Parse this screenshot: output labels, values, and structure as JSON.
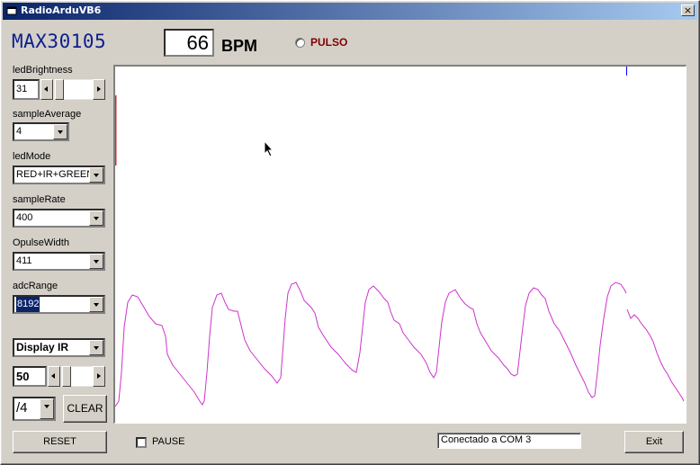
{
  "window": {
    "title": "RadioArduVB6",
    "close_glyph": "×"
  },
  "header": {
    "device": "MAX30105",
    "bpm_value": "66",
    "bpm_label": "BPM",
    "pulse_label": "PULSO"
  },
  "controls": {
    "led_brightness": {
      "label": "ledBrightness",
      "value": "31"
    },
    "sample_average": {
      "label": "sampleAverage",
      "value": "4"
    },
    "led_mode": {
      "label": "ledMode",
      "value": "RED+IR+GREEN"
    },
    "sample_rate": {
      "label": "sampleRate",
      "value": "400"
    },
    "pulse_width": {
      "label": "OpulseWidth",
      "value": "411"
    },
    "adc_range": {
      "label": "adcRange",
      "value": "8192"
    },
    "display": {
      "value": "Display IR"
    },
    "scale": {
      "value": "50"
    },
    "divider": {
      "value": "/4"
    },
    "clear_label": "CLEAR",
    "reset_label": "RESET"
  },
  "footer": {
    "pause_label": "PAUSE",
    "status": "Conectado a COM 3",
    "exit_label": "Exit"
  },
  "colors": {
    "trace": "#cc33cc",
    "title_text": "#0c1f8c",
    "pulse": "#800000"
  },
  "icons": {
    "app": "app-window-icon",
    "cursor": "mouse-pointer-icon"
  }
}
